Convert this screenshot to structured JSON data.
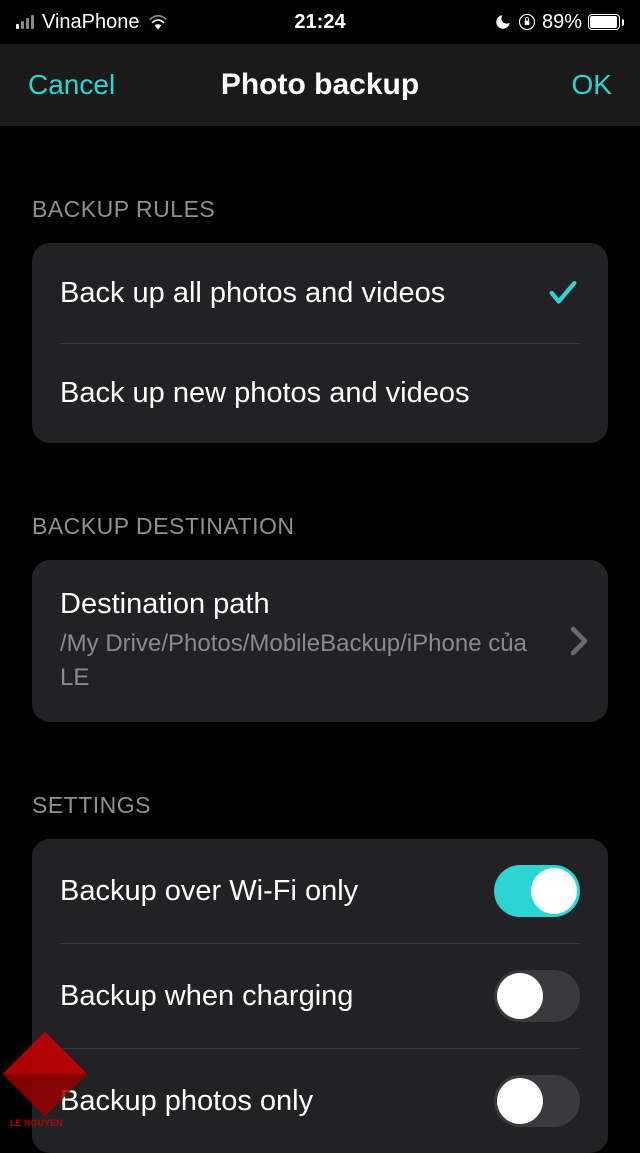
{
  "status": {
    "carrier": "VinaPhone",
    "time": "21:24",
    "battery_percent": "89%"
  },
  "nav": {
    "cancel": "Cancel",
    "title": "Photo backup",
    "ok": "OK"
  },
  "sections": {
    "rules": {
      "header": "BACKUP RULES",
      "option_all": "Back up all photos and videos",
      "option_new": "Back up new photos and videos",
      "selected": "all"
    },
    "destination": {
      "header": "BACKUP DESTINATION",
      "title": "Destination path",
      "path": "/My Drive/Photos/MobileBackup/iPhone của LE"
    },
    "settings": {
      "header": "SETTINGS",
      "wifi_only": {
        "label": "Backup over Wi-Fi only",
        "on": true
      },
      "charging": {
        "label": "Backup when charging",
        "on": false
      },
      "photos_only": {
        "label": "Backup photos only",
        "on": false
      }
    }
  },
  "watermark": "LE NGUYEN",
  "colors": {
    "accent": "#2dd4d4",
    "card": "#222224",
    "secondary_text": "#8a8a8e"
  }
}
